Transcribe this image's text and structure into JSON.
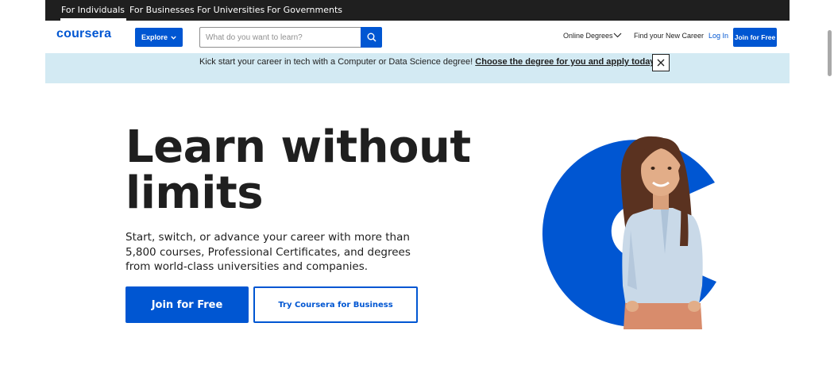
{
  "audience_nav": {
    "tabs": [
      {
        "label": "For Individuals",
        "active": true
      },
      {
        "label": "For Businesses",
        "active": false
      },
      {
        "label": "For Universities",
        "active": false
      },
      {
        "label": "For Governments",
        "active": false
      }
    ]
  },
  "header": {
    "logo_text": "coursera",
    "explore_label": "Explore",
    "search_placeholder": "What do you want to learn?",
    "online_degrees_label": "Online Degrees",
    "find_career_label": "Find your New Career",
    "login_label": "Log In",
    "join_label": "Join for Free"
  },
  "banner": {
    "text": "Kick start your career in tech with a Computer or Data Science degree! ",
    "link_text": "Choose the degree for you and apply today"
  },
  "hero": {
    "title_line1": "Learn without",
    "title_line2": "limits",
    "description": "Start, switch, or advance your career with more than 5,800 courses, Professional Certificates, and degrees from world-class universities and companies.",
    "join_button": "Join for Free",
    "business_button": "Try Coursera for Business"
  },
  "colors": {
    "brand_blue": "#0056d2",
    "top_bar": "#1f1f1f",
    "banner_bg": "#d3eaf3"
  },
  "icons": [
    "chevron-down-icon",
    "search-icon",
    "close-icon"
  ]
}
